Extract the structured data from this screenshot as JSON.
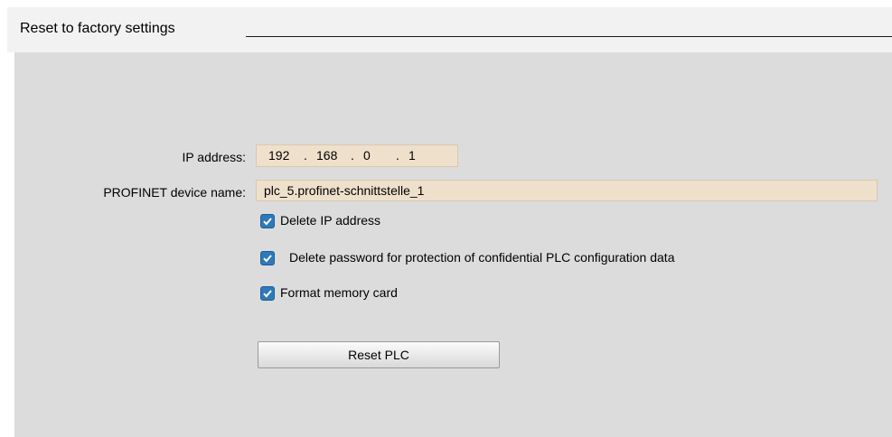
{
  "section": {
    "title": "Reset to factory settings"
  },
  "form": {
    "ip_label": "IP address:",
    "ip_octets": [
      "192",
      ".",
      "168",
      ".",
      "0",
      ".",
      "1"
    ],
    "device_name_label": "PROFINET device name:",
    "device_name_value": "plc_5.profinet-schnittstelle_1"
  },
  "options": [
    {
      "label": "Delete IP address",
      "checked": true
    },
    {
      "label": "Delete password for protection of confidential PLC configuration data",
      "checked": true
    },
    {
      "label": "Format memory card",
      "checked": true
    }
  ],
  "actions": {
    "reset_label": "Reset PLC"
  },
  "colors": {
    "input_bg": "#efe0cc",
    "checkbox_fill": "#2f79b9",
    "panel_bg": "#dcdcdc"
  },
  "icons": {
    "checkbox": "checkmark-icon"
  }
}
